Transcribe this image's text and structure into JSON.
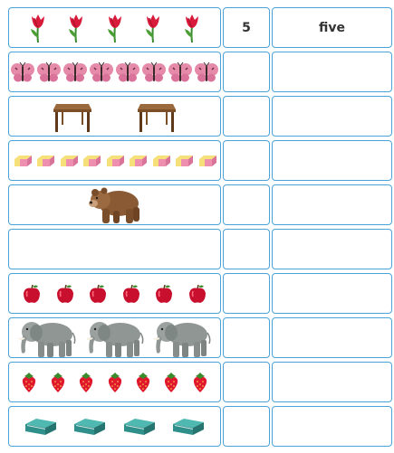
{
  "worksheet": {
    "rows": [
      {
        "object": "tulip",
        "icon": "tulip-icon",
        "count": 5,
        "numeral": "5",
        "word": "five"
      },
      {
        "object": "butterfly",
        "icon": "butterfly-icon",
        "count": 8,
        "numeral": "",
        "word": ""
      },
      {
        "object": "table",
        "icon": "table-icon",
        "count": 2,
        "numeral": "",
        "word": ""
      },
      {
        "object": "eraser",
        "icon": "eraser-icon",
        "count": 9,
        "numeral": "",
        "word": ""
      },
      {
        "object": "bear",
        "icon": "bear-icon",
        "count": 1,
        "numeral": "",
        "word": ""
      },
      {
        "object": "none",
        "icon": "",
        "count": 0,
        "numeral": "",
        "word": ""
      },
      {
        "object": "apple",
        "icon": "apple-icon",
        "count": 6,
        "numeral": "",
        "word": ""
      },
      {
        "object": "elephant",
        "icon": "elephant-icon",
        "count": 3,
        "numeral": "",
        "word": ""
      },
      {
        "object": "strawberry",
        "icon": "strawberry-icon",
        "count": 7,
        "numeral": "",
        "word": ""
      },
      {
        "object": "book",
        "icon": "book-icon",
        "count": 4,
        "numeral": "",
        "word": ""
      }
    ],
    "colors": {
      "border": "#4aa3d8",
      "text": "#333333"
    }
  }
}
